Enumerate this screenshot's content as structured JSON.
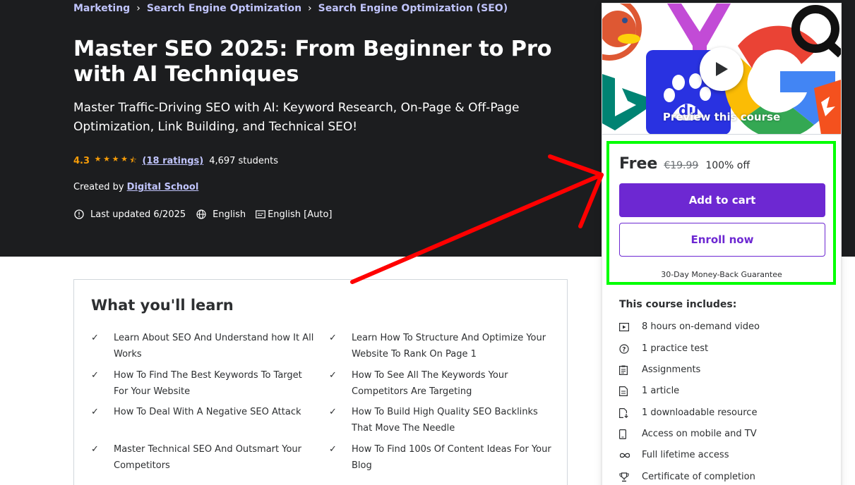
{
  "breadcrumb": {
    "items": [
      "Marketing",
      "Search Engine Optimization",
      "Search Engine Optimization (SEO)"
    ],
    "separator": "›"
  },
  "course": {
    "title": "Master SEO 2025: From Beginner to Pro with AI Techniques",
    "subtitle": "Master Traffic-Driving SEO with AI: Keyword Research, On-Page & Off-Page Optimization, Link Building, and Technical SEO!",
    "rating": "4.3",
    "ratings_count": "(18 ratings)",
    "students": "4,697 students",
    "created_by_label": "Created by",
    "creator": "Digital School",
    "last_updated": "Last updated 6/2025",
    "language": "English",
    "captions": "English [Auto]"
  },
  "learn": {
    "title": "What you'll learn",
    "items": [
      "Learn About SEO And Understand how It All Works",
      "Learn How To Structure And Optimize Your Website To Rank On Page 1",
      "How To Find The Best Keywords To Target For Your Website",
      "How To See All The Keywords Your Competitors Are Targeting",
      "How To Deal With A Negative SEO Attack",
      "How To Build High Quality SEO Backlinks That Move The Needle",
      "Master Technical SEO And Outsmart Your Competitors",
      "How To Find 100s Of Content Ideas For Your Blog"
    ]
  },
  "sidebar": {
    "preview_label": "Preview this course",
    "price": "Free",
    "original_price": "€19.99",
    "discount": "100% off",
    "add_to_cart": "Add to cart",
    "enroll_now": "Enroll now",
    "guarantee": "30-Day Money-Back Guarantee",
    "includes_title": "This course includes:",
    "includes": [
      {
        "icon": "video-icon",
        "label": "8 hours on-demand video"
      },
      {
        "icon": "question-icon",
        "label": "1 practice test"
      },
      {
        "icon": "assignment-icon",
        "label": "Assignments"
      },
      {
        "icon": "article-icon",
        "label": "1 article"
      },
      {
        "icon": "download-file-icon",
        "label": "1 downloadable resource"
      },
      {
        "icon": "mobile-icon",
        "label": "Access on mobile and TV"
      },
      {
        "icon": "infinity-icon",
        "label": "Full lifetime access"
      },
      {
        "icon": "trophy-icon",
        "label": "Certificate of completion"
      }
    ]
  },
  "colors": {
    "hero_bg": "#1c1d1f",
    "accent_purple": "#6d28d2",
    "link_lavender": "#c0c4fc",
    "star_orange": "#f69c08",
    "annotation_red": "#ff0000",
    "annotation_green": "#00ff00"
  }
}
